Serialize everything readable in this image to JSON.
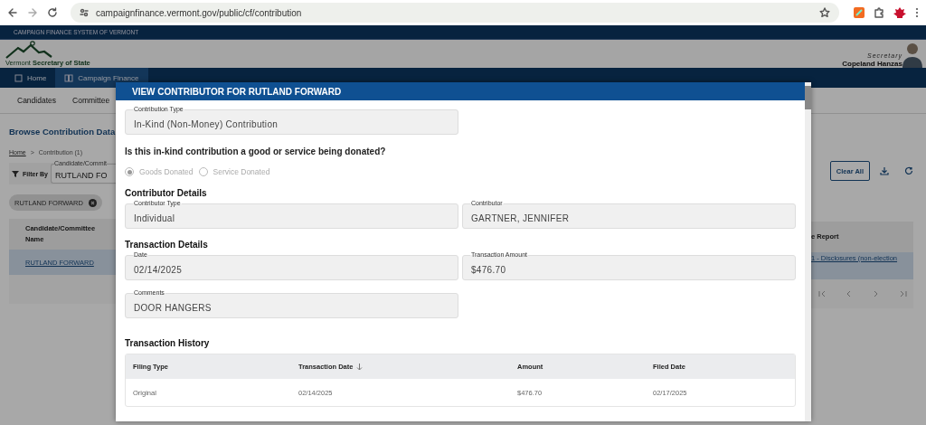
{
  "browser": {
    "url": "campaignfinance.vermont.gov/public/cf/contribution"
  },
  "site": {
    "banner": "CAMPAIGN FINANCE SYSTEM OF VERMONT",
    "logo_text": "Vermont **Secretary of State**",
    "secretary_title": "Secretary",
    "secretary_name": "Copeland Hanzas"
  },
  "nav": [
    {
      "label": "Home",
      "selected": false
    },
    {
      "label": "Campaign Finance",
      "selected": true
    }
  ],
  "subnav": [
    "Candidates",
    "Committee"
  ],
  "background": {
    "page_title": "Browse Contribution Data",
    "breadcrumb": [
      "Home",
      ">",
      "Contribution (1)"
    ],
    "filter_label": "Filter By",
    "filter_field": {
      "label": "Candidate/Commit",
      "value": "RUTLAND FO"
    },
    "chip": "RUTLAND FORWARD",
    "clear_button": "Clear All",
    "table": {
      "columns": [
        "Candidate/Committee Name",
        "e Report"
      ],
      "rows": [
        [
          "RUTLAND FORWARD",
          "1 - Disclosures (non-election"
        ]
      ]
    }
  },
  "modal": {
    "title": "VIEW CONTRIBUTOR FOR RUTLAND FORWARD",
    "contribution_type": {
      "label": "Contribution Type",
      "value": "In-Kind (Non-Money) Contribution"
    },
    "question": "Is this in-kind contribution a good or service being donated?",
    "options": [
      {
        "label": "Goods Donated",
        "selected": true,
        "disabled": true
      },
      {
        "label": "Service Donated",
        "selected": false,
        "disabled": true
      }
    ],
    "sections": [
      {
        "title": "Contributor Details",
        "fields": [
          {
            "label": "Contributor Type",
            "value": "Individual"
          },
          {
            "label": "Contributor",
            "value": "GARTNER, JENNIFER"
          }
        ]
      },
      {
        "title": "Transaction Details",
        "fields": [
          {
            "label": "Date",
            "value": "02/14/2025"
          },
          {
            "label": "Transaction Amount",
            "value": "$476.70"
          },
          {
            "label": "Comments",
            "value": "DOOR HANGERS"
          }
        ]
      }
    ],
    "history": {
      "title": "Transaction History",
      "columns": [
        {
          "label": "Filing Type",
          "sorted": false
        },
        {
          "label": "Transaction Date",
          "sorted": true
        },
        {
          "label": "Amount",
          "sorted": false
        },
        {
          "label": "Filed Date",
          "sorted": false
        }
      ],
      "rows": [
        [
          "Original",
          "02/14/2025",
          "$476.70",
          "02/17/2025"
        ]
      ]
    }
  }
}
